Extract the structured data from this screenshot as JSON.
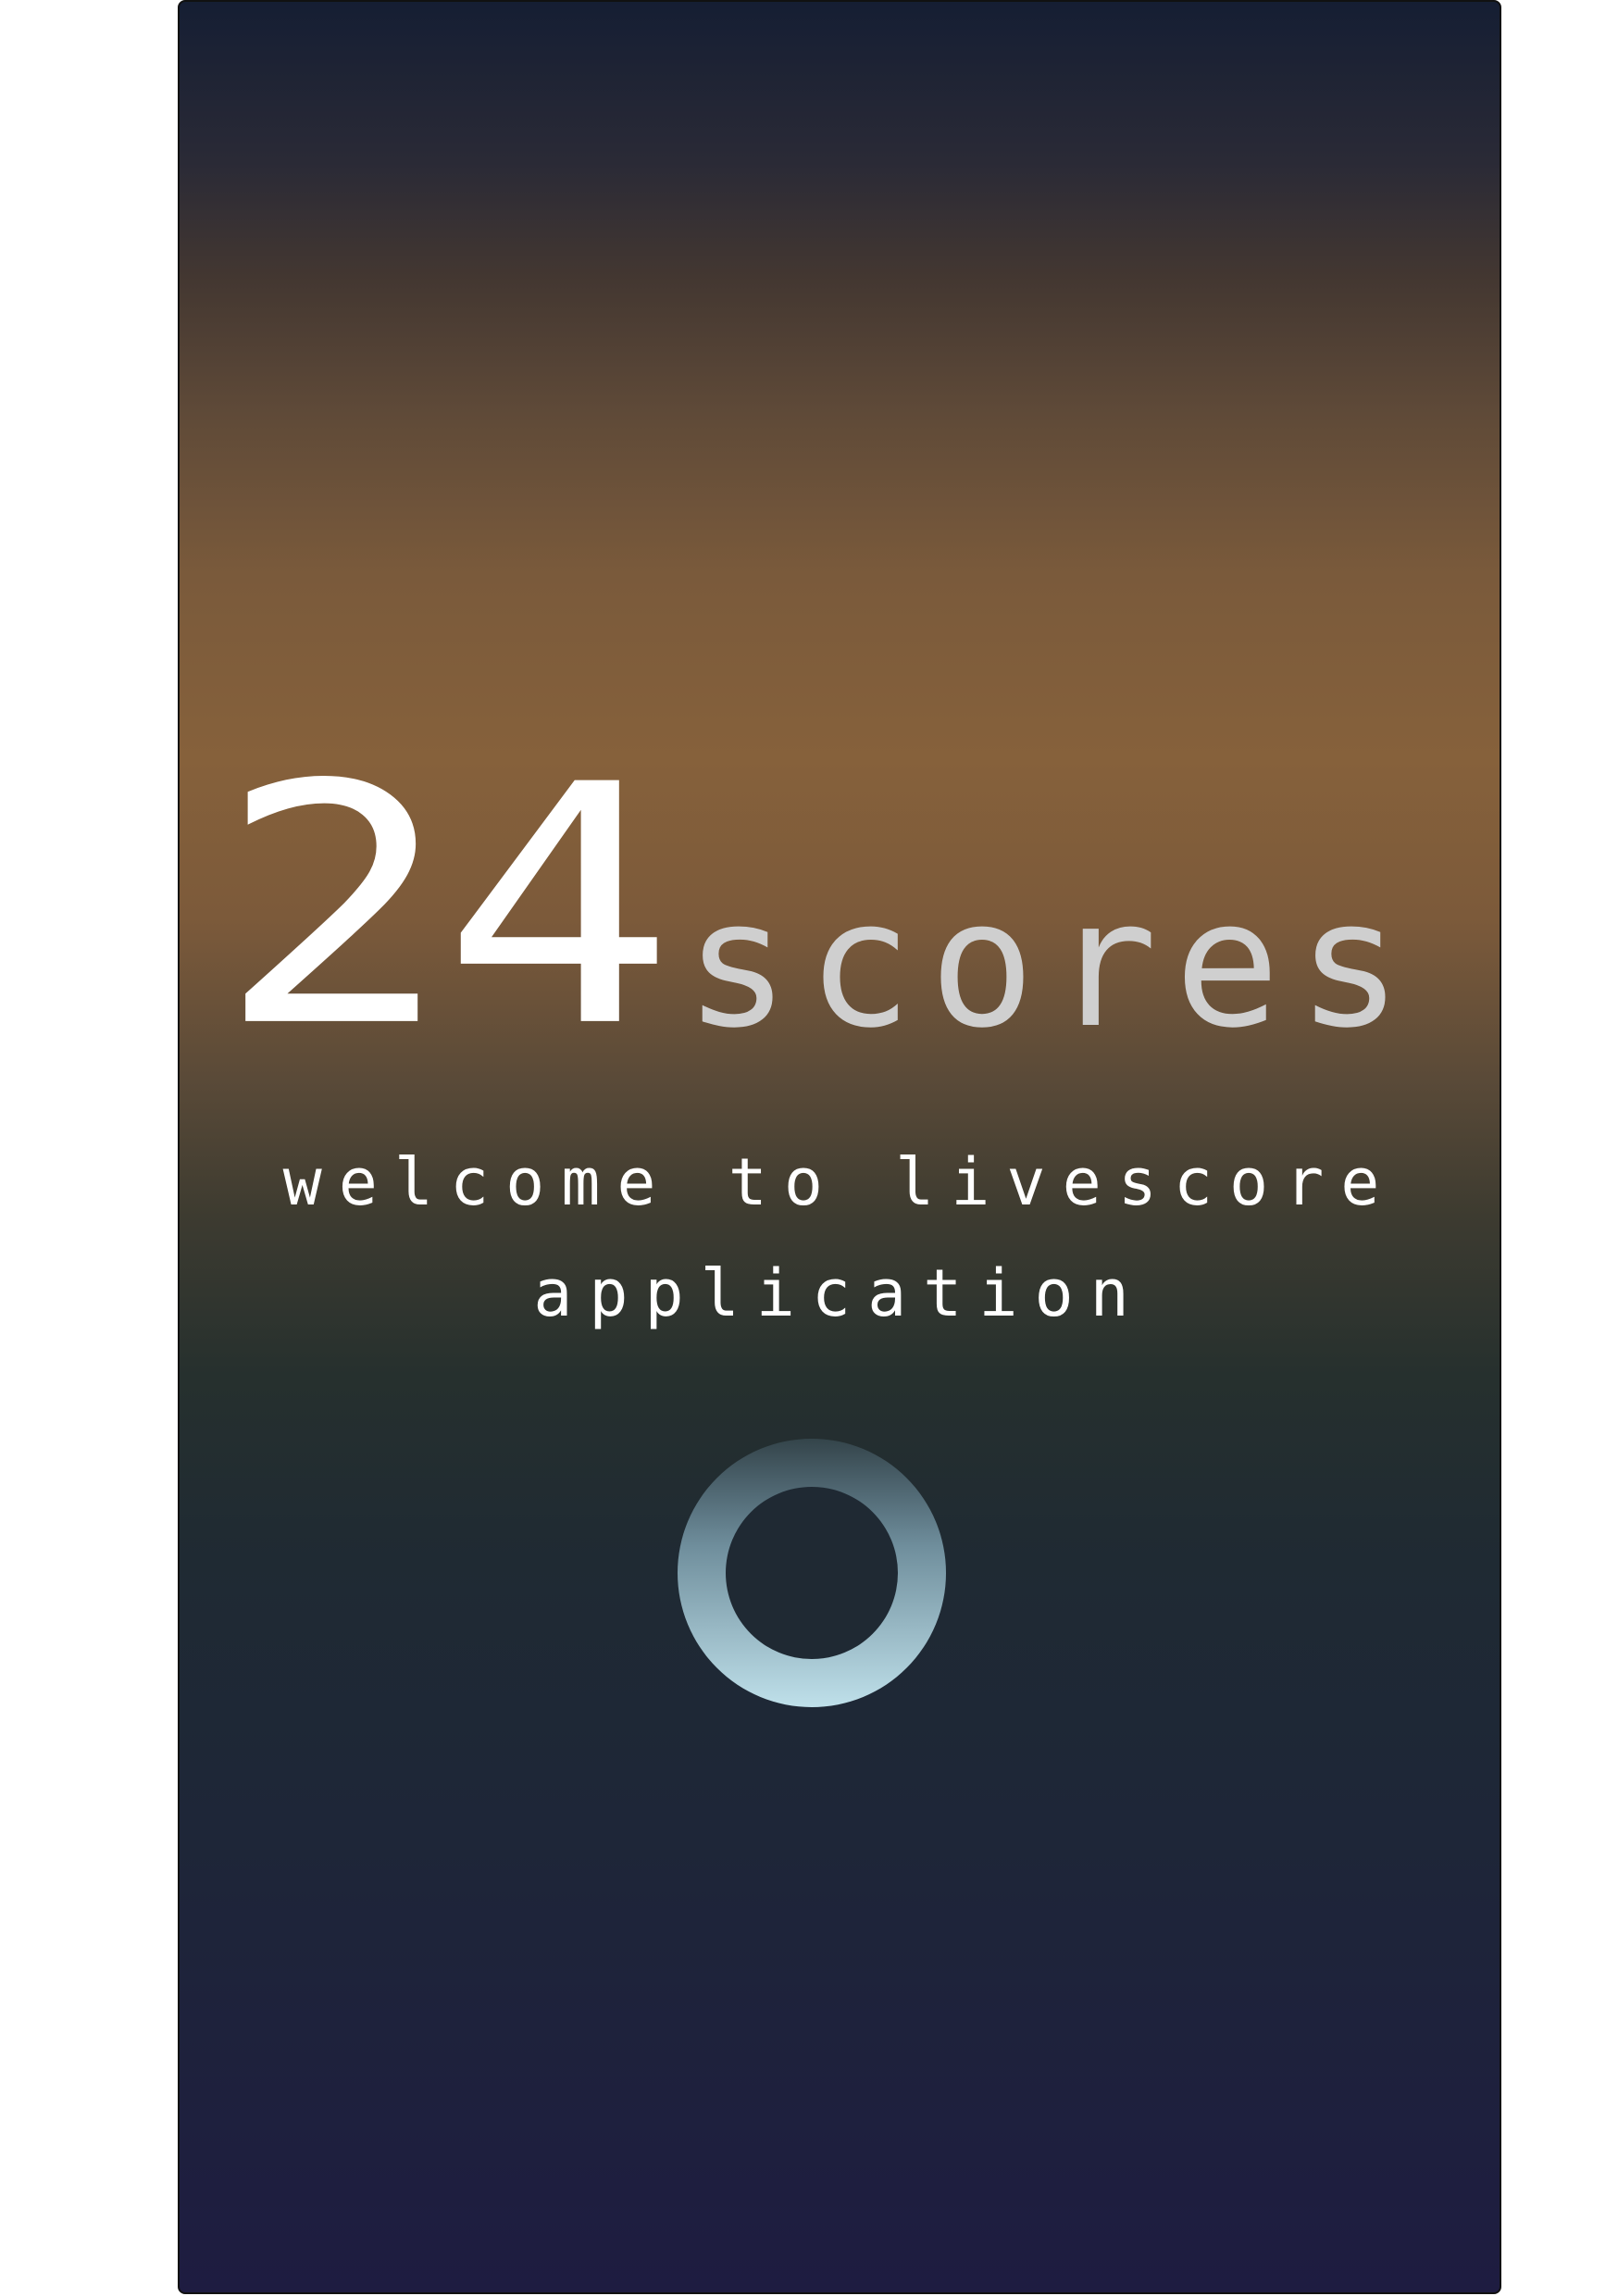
{
  "splash": {
    "logo_number": "24",
    "logo_word": "scores",
    "welcome_line1": "welcome to livescore",
    "welcome_line2": "application"
  },
  "loading": {
    "icon": "loading-spinner-icon"
  },
  "colors": {
    "background_top": "#151e33",
    "background_mid": "#86613b",
    "background_bottom": "#1e1c41",
    "logo_number": "#ffffff",
    "logo_word": "#cfcfcf",
    "spinner": "#bfe0ea"
  }
}
